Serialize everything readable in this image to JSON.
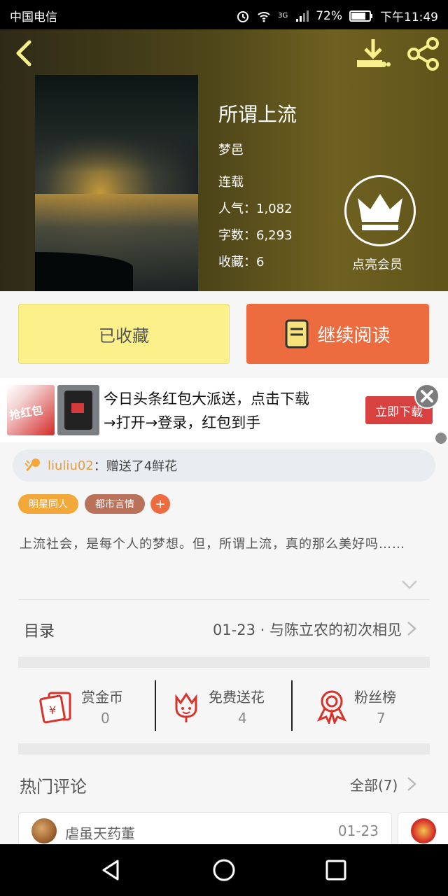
{
  "status_bar": {
    "carrier": "中国电信",
    "network": "3G",
    "battery": "72%",
    "time": "下午11:49"
  },
  "book": {
    "title": "所谓上流",
    "author": "梦邑",
    "status": "连载",
    "popularity": "人气：1,082",
    "word_count": "字数：6,293",
    "favorites": "收藏：6",
    "vip_label": "点亮会员"
  },
  "actions": {
    "favorited_label": "已收藏",
    "continue_label": "继续阅读"
  },
  "ad": {
    "image_text": "抢红包",
    "line1": "今日头条红包大派送，点击下载",
    "line2": "→打开→登录，红包到手",
    "download_label": "立即下载"
  },
  "gift_message": {
    "user": "liuliu02",
    "text": "：赠送了4鲜花"
  },
  "tags": [
    {
      "label": "明星同人",
      "color": "#f3a83a"
    },
    {
      "label": "都市言情",
      "color": "#b9715a"
    }
  ],
  "description": "上流社会，是每个人的梦想。但，所谓上流，真的那么美好吗……",
  "toc": {
    "label": "目录",
    "latest_chapter": "01-23 · 与陈立农的初次相见"
  },
  "stats": [
    {
      "label": "赏金币",
      "value": "0",
      "icon": "red-envelope-icon"
    },
    {
      "label": "免费送花",
      "value": "4",
      "icon": "flower-icon"
    },
    {
      "label": "粉丝榜",
      "value": "7",
      "icon": "medal-icon"
    }
  ],
  "comments": {
    "title": "热门评论",
    "all_label": "全部(7)",
    "items": [
      {
        "user": "虐虽天药董",
        "date": "01-23"
      }
    ]
  },
  "colors": {
    "accent": "#ec6c40",
    "favorite_button": "#fbf08a",
    "stat_icon": "#d8332a"
  }
}
